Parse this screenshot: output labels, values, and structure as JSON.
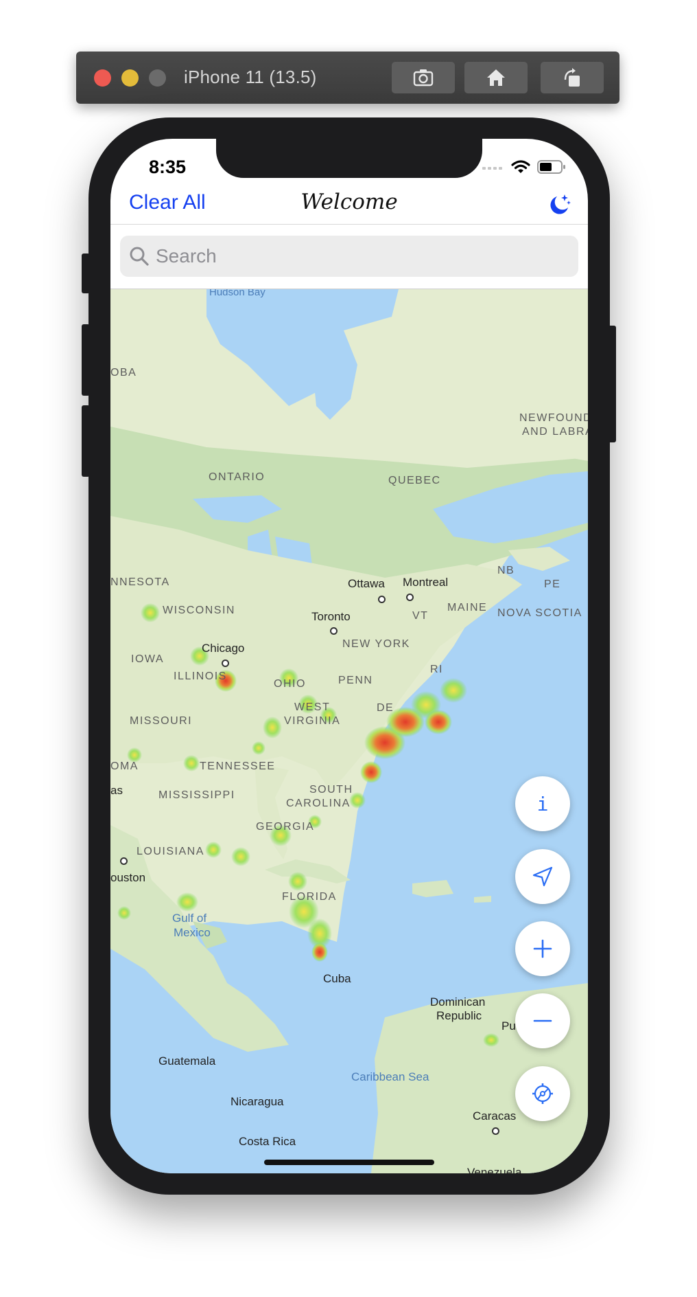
{
  "simulator": {
    "title": "iPhone 11 (13.5)",
    "buttons": [
      "screenshot",
      "home",
      "rotate"
    ]
  },
  "status_bar": {
    "time": "8:35",
    "icons": [
      "cellular-icon",
      "wifi-icon",
      "battery-icon"
    ]
  },
  "navbar": {
    "left_label": "Clear All",
    "title": "Welcome",
    "right_icon": "moon-stars-icon"
  },
  "search": {
    "placeholder": "Search",
    "value": ""
  },
  "map": {
    "regions": {
      "ontario": "ONTARIO",
      "quebec": "QUEBEC",
      "newfoundland": "NEWFOUND",
      "labrador": "AND LABRA",
      "manitoba": "OBA",
      "minnesota": "NNESOTA",
      "wisconsin": "WISCONSIN",
      "iowa": "IOWA",
      "illinois": "ILLINOIS",
      "missouri": "MISSOURI",
      "ohio": "OHIO",
      "penn": "PENN",
      "west": "WEST",
      "virginia": "VIRGINIA",
      "tennessee": "TENNESSEE",
      "oma": "OMA",
      "mississippi": "MISSISSIPPI",
      "south": "SOUTH",
      "carolina": "CAROLINA",
      "georgia": "GEORGIA",
      "louisiana": "LOUISIANA",
      "florida": "FLORIDA",
      "new_york": "NEW YORK",
      "vt": "VT",
      "maine": "MAINE",
      "nb": "NB",
      "pe": "PE",
      "nova_scotia": "NOVA SCOTIA",
      "de": "DE",
      "ri": "RI"
    },
    "cities": {
      "ottawa": "Ottawa",
      "montreal": "Montreal",
      "toronto": "Toronto",
      "chicago": "Chicago",
      "houston": "ouston",
      "cuba": "Cuba",
      "dominican_1": "Dominican",
      "dominican_2": "Republic",
      "puerto": "Pu",
      "guatemala": "Guatemala",
      "nicaragua": "Nicaragua",
      "costa_rica": "Costa Rica",
      "caracas": "Caracas",
      "venezuela": "Venezuela",
      "as": "as"
    },
    "water": {
      "gulf_1": "Gulf of",
      "gulf_2": "Mexico",
      "caribbean": "Caribbean Sea",
      "hudson": "Hudson Bay"
    },
    "heatmap_layer": "visible"
  },
  "fabs": {
    "info_label": "i",
    "locate_icon": "location-arrow-icon",
    "zoom_in_icon": "plus-icon",
    "zoom_out_icon": "minus-icon",
    "settings_icon": "settings-gear-icon"
  },
  "colors": {
    "tint": "#1540f0",
    "fab_icon": "#2a6df4",
    "land": "#e4ecd0",
    "forest": "#c7dfb4",
    "water": "#aad3f5",
    "heat_low": "#7ed957",
    "heat_mid": "#f2e24a",
    "heat_high": "#e23b2a"
  }
}
